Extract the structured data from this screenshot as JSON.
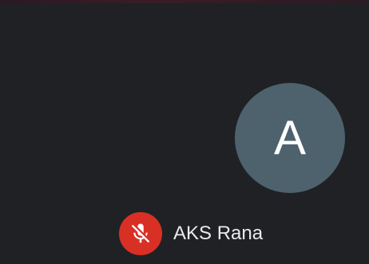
{
  "participant": {
    "avatar_initial": "A",
    "name": "AKS Rana",
    "muted": true
  },
  "icons": {
    "mute": "mic-off-icon"
  },
  "colors": {
    "tile_background": "#202124",
    "avatar_background": "#4d626d",
    "mute_badge_background": "#d93025"
  }
}
